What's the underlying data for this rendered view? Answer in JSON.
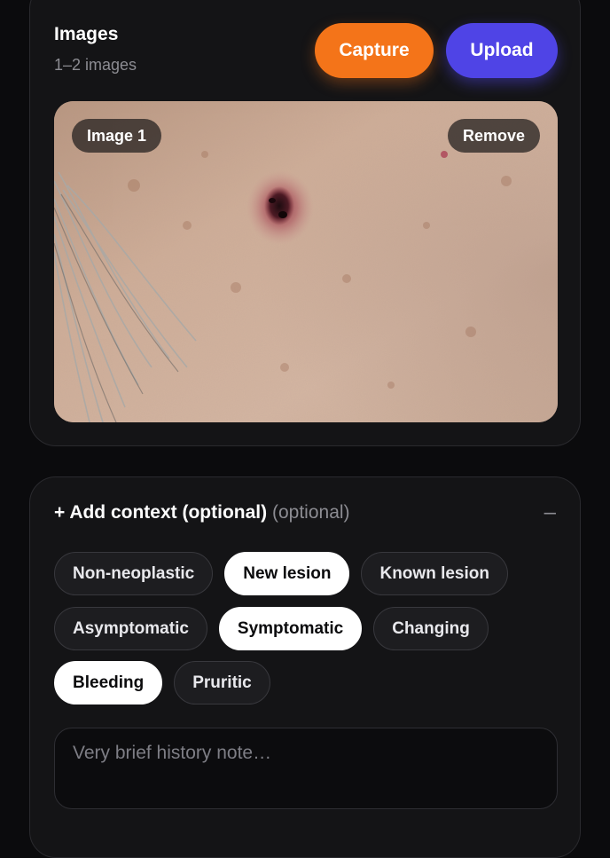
{
  "images_section": {
    "title": "Images",
    "subtitle": "1–2 images",
    "capture_label": "Capture",
    "upload_label": "Upload",
    "image_badge": "Image 1",
    "remove_label": "Remove",
    "colors": {
      "capture": "#f47419",
      "upload": "#4f44e6"
    }
  },
  "context_section": {
    "title": "+ Add context (optional)",
    "title_suffix": "(optional)",
    "collapse_symbol": "–",
    "chips": [
      {
        "label": "Non-neoplastic",
        "selected": false
      },
      {
        "label": "New lesion",
        "selected": true
      },
      {
        "label": "Known lesion",
        "selected": false
      },
      {
        "label": "Asymptomatic",
        "selected": false
      },
      {
        "label": "Symptomatic",
        "selected": true
      },
      {
        "label": "Changing",
        "selected": false
      },
      {
        "label": "Bleeding",
        "selected": true
      },
      {
        "label": "Pruritic",
        "selected": false
      }
    ],
    "history_placeholder": "Very brief history note…",
    "history_value": ""
  }
}
